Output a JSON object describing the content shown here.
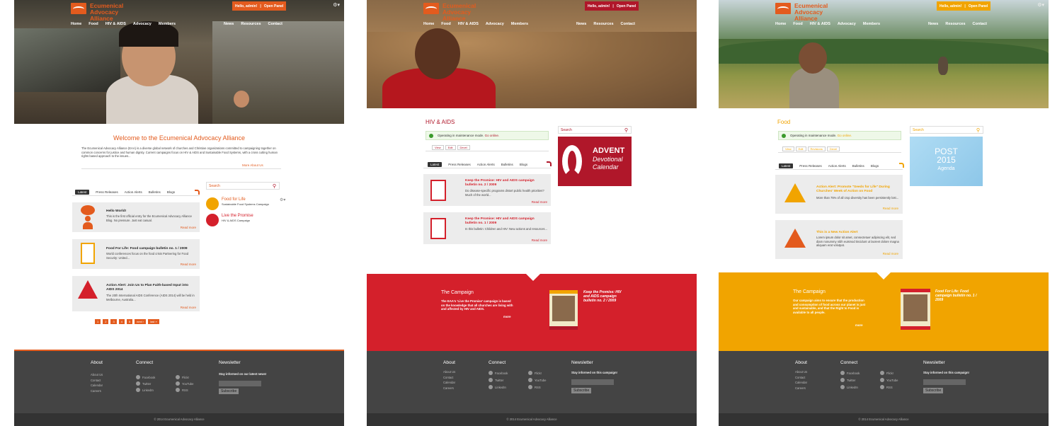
{
  "brand": {
    "name_line1": "Ecumenical Advocacy",
    "name_line2": "Alliance"
  },
  "topbar": {
    "greeting": "Hello, admin!",
    "sep": "|",
    "panel": "Open Panel"
  },
  "nav": {
    "left": [
      "Home",
      "Food",
      "HIV & AIDS",
      "Advocacy",
      "Members"
    ],
    "right": [
      "News",
      "Resources",
      "Contact"
    ]
  },
  "home": {
    "welcome_title": "Welcome to the Ecumenical Advocacy Alliance",
    "welcome_text": "The Ecumenical Advocacy Alliance (EAA) is a diverse global network of churches and Christian organizations committed to campaigning together on common concerns for justice and human dignity. Current campaigns focus on HIV & AIDS and Sustainable Food Systems, with a cross cutting human rights based approach to the issues...",
    "more_about": "More About Us",
    "tabs": [
      "Latest",
      "Press Releases",
      "Action Alerts",
      "Bulletins",
      "Blogs"
    ],
    "cards": [
      {
        "title": "Hello World!",
        "desc": "This is the first official entry for the Ecumenical Advocacy Alliance Blog. No pressure. Just eat casual.",
        "more": "Read more"
      },
      {
        "title": "Food For Life: Food campaign bulletin no. 1 / 2009",
        "desc": "World conferences focus on the food crisis Partnering for Food Security: United...",
        "more": "Read more"
      },
      {
        "title": "Action Alert: Join Us to Plan Faith-based Input into AIDS 2014",
        "desc": "The 20th International AIDS Conference (AIDS 2014) will be held in Melbourne, Australia...",
        "more": "Read more"
      }
    ],
    "pager": [
      "1",
      "2",
      "3",
      "4",
      "5",
      "next ›",
      "last »"
    ],
    "search_placeholder": "Search",
    "sidebar": [
      {
        "title": "Food for Life",
        "sub": "Sustainable Food Systems Campaign"
      },
      {
        "title": "Live the Promise",
        "sub": "HIV & AIDS Campaign"
      }
    ]
  },
  "hiv": {
    "section": "HIV & AIDS",
    "maintenance": "Operating in maintenance mode.",
    "go_online": "Go online.",
    "edit_tabs": [
      "View",
      "Edit",
      "Devel"
    ],
    "tabs": [
      "Latest",
      "Press Releases",
      "Action Alerts",
      "Bulletins",
      "Blogs"
    ],
    "cards": [
      {
        "title": "Keep the Promise: HIV and AIDS campaign bulletin no. 2 / 2009",
        "desc": "Do disease-specific programs distort public health priorities? Much of the world...",
        "more": "Read more"
      },
      {
        "title": "Keep the Promise: HIV and AIDS campaign bulletin no. 1 / 2009",
        "desc": "In this bulletin: Children and HIV: New actions and resources...",
        "more": "Read more"
      }
    ],
    "search_placeholder": "Search",
    "advent": {
      "l1": "ADVENT",
      "l2": "Devotional",
      "l3": "Calendar"
    },
    "campaign_title": "The Campaign",
    "campaign_text": "The EAA's 'Live the Promise' campaign is based on the knowledge that all churches are living with and affected by HIV and AIDS.",
    "campaign_more": "more",
    "bulletin": "Keep the Promise: HIV and AIDS campaign bulletin no. 2 / 2009"
  },
  "food": {
    "section": "Food",
    "maintenance": "Operating in maintenance mode.",
    "go_online": "Go online.",
    "edit_tabs": [
      "View",
      "Edit",
      "Revisions",
      "Devel"
    ],
    "tabs": [
      "Latest",
      "Press Releases",
      "Action Alerts",
      "Bulletins",
      "Blogs"
    ],
    "cards": [
      {
        "title": "Action Alert: Promote \"Seeds for Life\" During Churches' Week of Action on Food",
        "desc": "More than 75% of all crop diversity has been persistently lost...",
        "more": "Read more"
      },
      {
        "title": "This is a New Action Alert",
        "desc": "Lorem ipsum dolor sit amet, consectetuer adipiscing elit, sed diam nonummy nibh euismod tincidunt ut laoreet dolore magna aliquam erat volutpat.",
        "more": "Read more"
      }
    ],
    "search_placeholder": "Search",
    "post2015": {
      "l1": "POST",
      "l2": "2015",
      "l3": "Agenda"
    },
    "campaign_title": "The Campaign",
    "campaign_text": "Our campaign aims to ensure that the production and consumption of food across our planet is just and sustainable, and that the Right to Food is available to all people.",
    "campaign_more": "more",
    "bulletin": "Food For Life: Food campaign bulletin no. 1 / 2009"
  },
  "footer": {
    "about_title": "About",
    "about_links": [
      "About Us",
      "Contact",
      "Calendar",
      "Careers"
    ],
    "connect_title": "Connect",
    "connect_col1": [
      "Facebook",
      "Twitter",
      "LinkedIn"
    ],
    "connect_col2": [
      "Flickr",
      "YouTube",
      "RSS"
    ],
    "newsletter_title": "Newsletter",
    "home_newsletter_text": "Stay informed on our latest news!",
    "campaign_newsletter_text": "Stay informed on this campaign!",
    "subscribe": "Subscribe",
    "copyright": "© 2014 Ecumenical Advocacy Alliance"
  },
  "colors": {
    "orange": "#e35b1e",
    "red": "#b0172a",
    "campaign_red": "#d4202b",
    "gold": "#f1a400",
    "footer": "#444444"
  }
}
